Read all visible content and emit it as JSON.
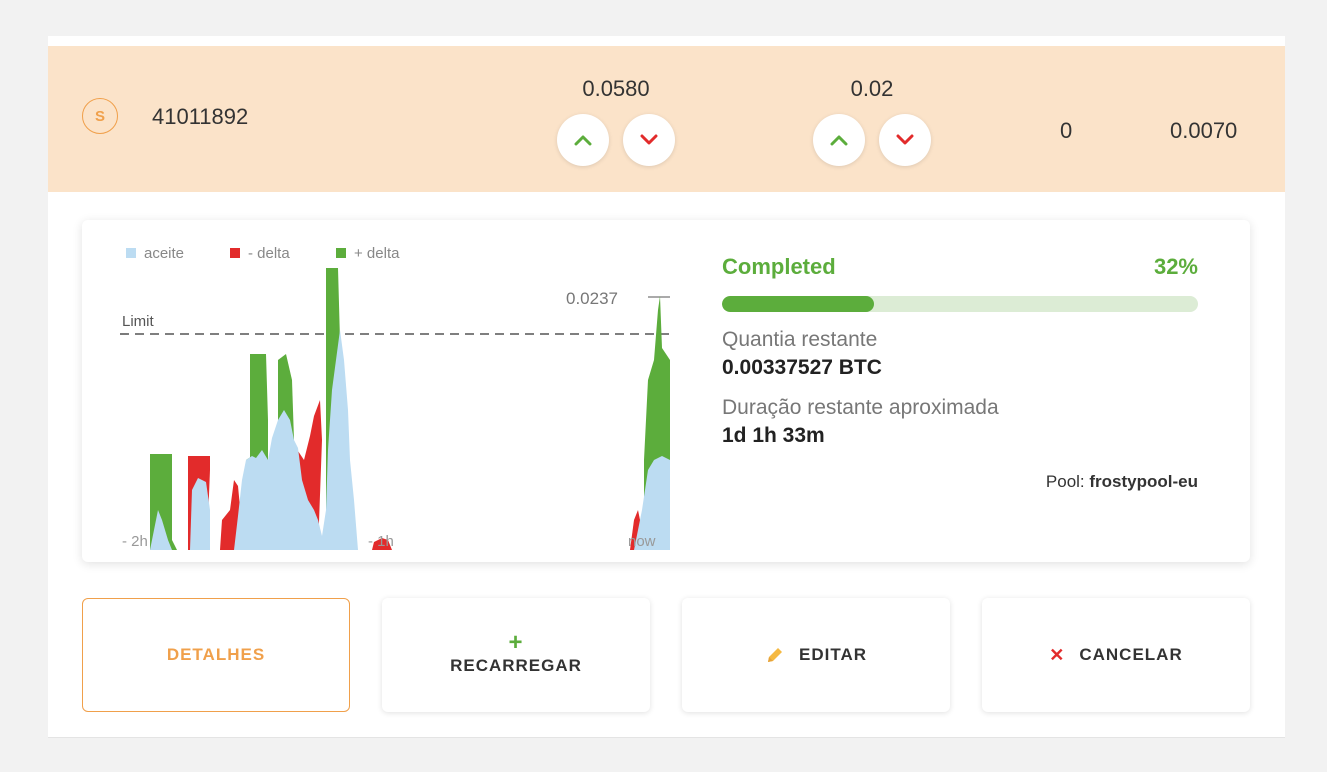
{
  "order": {
    "coin_icon_letter": "S",
    "id": "41011892",
    "price": "0.0580",
    "limit": "0.02",
    "stat_a": "0",
    "stat_b": "0.0070"
  },
  "chart": {
    "legend": [
      {
        "label": "aceite",
        "color": "#bcdcf2"
      },
      {
        "label": "- delta",
        "color": "#e22b2b"
      },
      {
        "label": "+ delta",
        "color": "#5cad3c"
      }
    ],
    "limit_label": "Limit",
    "current_value_label": "0.0237",
    "x_labels": [
      "- 2h",
      "- 1h",
      "now"
    ]
  },
  "progress": {
    "label": "Completed",
    "percent_label": "32%",
    "percent": 32
  },
  "remaining_amount": {
    "label": "Quantia restante",
    "value": "0.00337527 BTC"
  },
  "remaining_duration": {
    "label": "Duração restante aproximada",
    "value": "1d 1h 33m"
  },
  "pool": {
    "label": "Pool:",
    "value": "frostypool-eu"
  },
  "actions": {
    "details": "DETALHES",
    "reload": "RECARREGAR",
    "edit": "EDITAR",
    "cancel": "CANCELAR"
  },
  "colors": {
    "accent_orange": "#f0a04b",
    "green": "#5cad3c",
    "red": "#e22b2b",
    "light_blue": "#bcdcf2",
    "row_bg": "#fbe3c9"
  }
}
